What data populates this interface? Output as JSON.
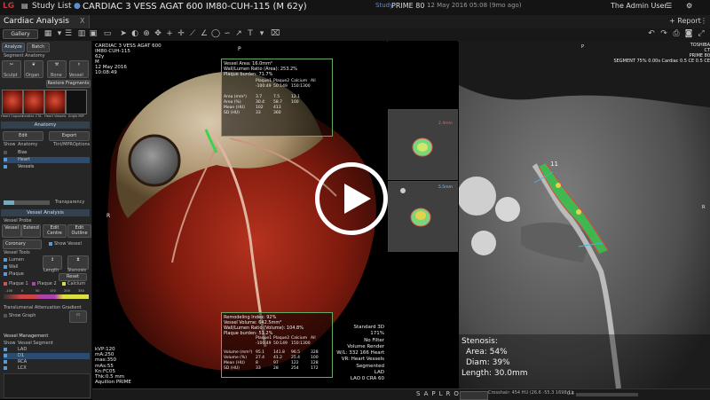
{
  "topbar": {
    "logo": "LG",
    "study_list": "Study List",
    "patient_title": "CARDIAC 3 VESS AGAT 600  IM80-CUH-115 (M 62y)",
    "study_label": "Study",
    "study_name": "PRIME 80",
    "study_date": "12 May 2016 05:08 (9mo ago)",
    "user": "The Admin User",
    "report": "+ Report"
  },
  "toolbar2": {
    "app_title": "Cardiac Analysis",
    "close": "X"
  },
  "toolbar3": {
    "gallery": "Gallery"
  },
  "left_panel": {
    "tabs": [
      "Analyze",
      "Batch"
    ],
    "segment_anatomy": "Segment Anatomy",
    "seg_buttons": [
      "Sculpt",
      "Organ",
      "Bone",
      "Vessel"
    ],
    "restore_fragments": "Restore Fragments",
    "thumbs": [
      "Heart Capsule",
      "Cardiac CTA",
      "Heart Vessels",
      "Angio MIP"
    ],
    "anatomy_head": "Anatomy",
    "edit": "Edit",
    "export": "Export",
    "anatomy_cols": [
      "Show",
      "Anatomy",
      "Tint/MPR",
      "Options"
    ],
    "anatomy_rows": [
      "Bias",
      "Heart",
      "Vessels"
    ],
    "transparency": "Transparency",
    "vessel_analysis_head": "Vessel Analysis",
    "vessel_probe": "Vessel Probe",
    "probe_buttons": [
      "Vessel",
      "Extend",
      "Edit Centre",
      "Edit Outline"
    ],
    "coronary": "Coronary",
    "show_vessel": "Show Vessel",
    "vessel_tools": "Vessel Tools",
    "tools_rows": [
      "Lumen",
      "Wall",
      "Plaque"
    ],
    "length": "Length",
    "stenosis_btn": "Stenosis",
    "reset": "Reset",
    "plaque_labels": [
      "Plaque 1",
      "Plaque 2",
      "Calcium"
    ],
    "scale_ticks": [
      "-100",
      "0",
      "50",
      "150",
      "200",
      "350"
    ],
    "translumenal": "Translumenal Attenuation Gradient",
    "show_graph": "Show Graph",
    "vessel_management": "Vessel Management",
    "vm_cols": [
      "Show",
      "Vessel Segment"
    ],
    "vm_rows": [
      "LAD",
      "D1",
      "RCA",
      "LCX"
    ]
  },
  "vp3d": {
    "info_lines": [
      "CARDIAC 3 VESS AGAT 600",
      "IM80-CUH-115",
      "62y",
      "M",
      "12 May 2016",
      "10:08:49"
    ],
    "orient_top": "P",
    "orient_left": "R",
    "bottom_left": [
      "kVP:120",
      "mA:250",
      "mas:350",
      "mAs:55",
      "Kn:FC05",
      "Thk:0.5 mm",
      "Aquilion PRIME"
    ],
    "right_lines": [
      "Standard 3D",
      "171%",
      "No Filter",
      "Volume Render",
      "W/L: 332 166 Heart",
      "VR: Heart Vessels",
      "Segmented",
      "LAD",
      "LAO 0  CRA 60"
    ],
    "box_top": {
      "title": "Vessel Area: 16.0mm²",
      "line2": "Wall/Lumen Ratio (Area): 253.2%",
      "line3": "Plaque burden: 71.7%",
      "cols": [
        "Plaque1",
        "Plaque2",
        "Calcium",
        "All"
      ],
      "ranges": [
        "-100:49",
        "50:149",
        "150:1300",
        ""
      ],
      "rows": [
        [
          "Area (mm²)",
          "3.7",
          "7.5",
          "12.1"
        ],
        [
          "Area (%)",
          "30.4",
          "58.7",
          "100"
        ],
        [
          "Mean (HU)",
          "102",
          "413",
          ""
        ],
        [
          "SD (HU)",
          "33",
          "360",
          ""
        ]
      ]
    },
    "box_bottom": {
      "line1": "Remodeling Index: 92%",
      "line2": "Vessel Volume: 642.5mm³",
      "line3": "Wall/Lumen Ratio (Volume): 104.8%",
      "line4": "Plaque burden: 51.2%",
      "cols": [
        "Plaque1",
        "Plaque2",
        "Calcium",
        "All"
      ],
      "ranges": [
        "-100:49",
        "50:149",
        "150:1300",
        ""
      ],
      "rows": [
        [
          "Volume (mm³)",
          "95.1",
          "141.8",
          "96.5",
          "328"
        ],
        [
          "Volume (%)",
          "27.4",
          "41.2",
          "25.4",
          "100"
        ],
        [
          "Mean (HU)",
          "8",
          "97",
          "122",
          "128"
        ],
        [
          "SD (HU)",
          "33",
          "28",
          "254",
          "172"
        ]
      ]
    },
    "toolbar_letters": [
      "S",
      "A",
      "P",
      "L",
      "R",
      "O"
    ]
  },
  "vpcurved": {
    "header_right": [
      "TOSHIBA",
      "CT",
      "PRIME 80",
      "SEGMENT 75% 0.00s Cardiac 0.5 CE  0.5 CE"
    ],
    "marker": "11",
    "orient": "P",
    "side": "R",
    "stenosis_title": "Stenosis:",
    "area": "Area: 54%",
    "diam": "Diam: 39%",
    "length": "Length: 30.0mm",
    "bottom_status": "Crosshair: 454 HU (26.6 -55.3 1698.1)",
    "zoom_label": "0.4"
  },
  "mini": {
    "m1_label": "2.4mm",
    "m2_label": "5.5mm"
  },
  "colors": {
    "panel_head": "#33414f",
    "vessel_green": "#39c24a",
    "heart_red": "#8a1e10"
  }
}
